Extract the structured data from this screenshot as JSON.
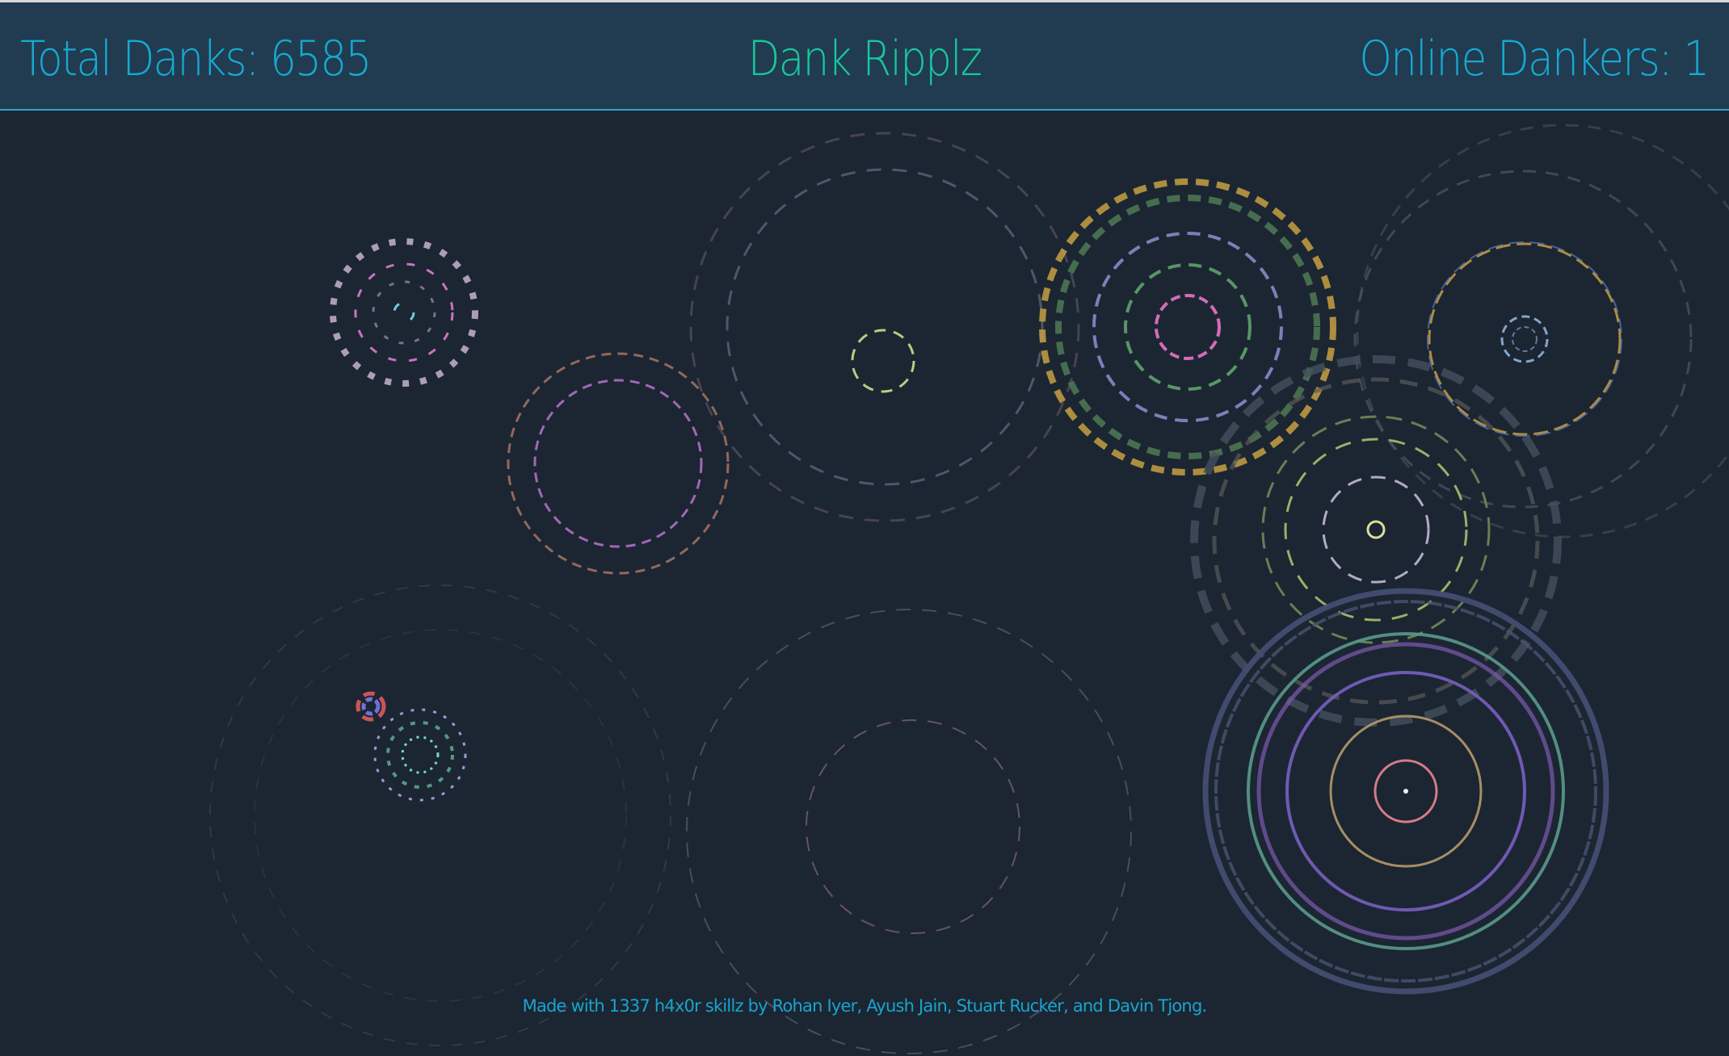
{
  "header": {
    "total_danks": "Total Danks: 6585",
    "title": "Dank Ripplz",
    "online_dankers": "Online Dankers: 1"
  },
  "footer": {
    "credits": "Made with 1337 h4x0r skillz by Rohan Iyer, Ayush Jain, Stuart Rucker, and Davin Tjong."
  },
  "colors": {
    "background": "#1b2632",
    "header_background": "#213b50",
    "header_border": "#2aa7cf",
    "counter_text": "#16a9d1",
    "title_text": "#19c79a",
    "footer_text": "#1aa3cf"
  }
}
